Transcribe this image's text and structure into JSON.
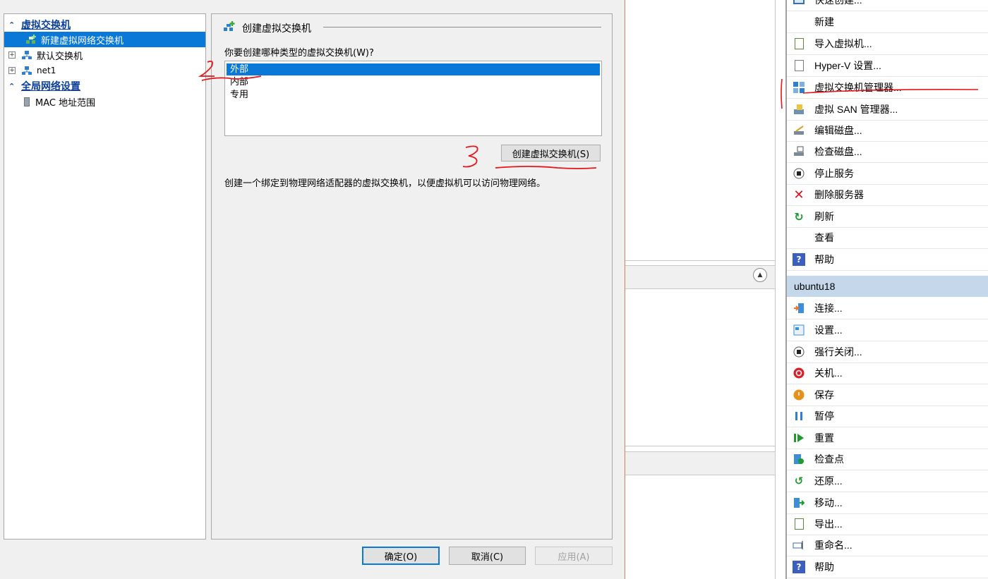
{
  "actions": {
    "top_items": [
      {
        "label": "快速创建...",
        "icon": "monitor-icon"
      },
      {
        "label": "新建",
        "icon": ""
      },
      {
        "label": "导入虚拟机...",
        "icon": "import-icon"
      },
      {
        "label": "Hyper-V 设置...",
        "icon": "settings-doc-icon"
      },
      {
        "label": "虚拟交换机管理器...",
        "icon": "switch-manager-icon"
      },
      {
        "label": "虚拟 SAN 管理器...",
        "icon": "san-manager-icon"
      },
      {
        "label": "编辑磁盘...",
        "icon": "edit-disk-icon"
      },
      {
        "label": "检查磁盘...",
        "icon": "inspect-disk-icon"
      },
      {
        "label": "停止服务",
        "icon": "stop-icon"
      },
      {
        "label": "删除服务器",
        "icon": "delete-icon"
      },
      {
        "label": "刷新",
        "icon": "refresh-icon"
      },
      {
        "label": "查看",
        "icon": ""
      },
      {
        "label": "帮助",
        "icon": "help-icon"
      }
    ],
    "vm_name": "ubuntu18",
    "vm_items": [
      {
        "label": "连接...",
        "icon": "connect-icon"
      },
      {
        "label": "设置...",
        "icon": "settings-icon"
      },
      {
        "label": "强行关闭...",
        "icon": "turn-off-icon"
      },
      {
        "label": "关机...",
        "icon": "shutdown-icon"
      },
      {
        "label": "保存",
        "icon": "save-icon"
      },
      {
        "label": "暂停",
        "icon": "pause-icon"
      },
      {
        "label": "重置",
        "icon": "reset-icon"
      },
      {
        "label": "检查点",
        "icon": "checkpoint-icon"
      },
      {
        "label": "还原...",
        "icon": "revert-icon"
      },
      {
        "label": "移动...",
        "icon": "move-icon"
      },
      {
        "label": "导出...",
        "icon": "export-icon"
      },
      {
        "label": "重命名...",
        "icon": "rename-icon"
      },
      {
        "label": "帮助",
        "icon": "help-icon"
      }
    ]
  },
  "dialog": {
    "tree": {
      "section1": "虚拟交换机",
      "new_switch": "新建虚拟网络交换机",
      "default_switch": "默认交换机",
      "net1": "net1",
      "section2": "全局网络设置",
      "mac_range": "MAC 地址范围"
    },
    "group_title": "创建虚拟交换机",
    "question": "你要创建哪种类型的虚拟交换机(W)?",
    "types": [
      "外部",
      "内部",
      "专用"
    ],
    "selected_type": "外部",
    "create_button": "创建虚拟交换机(S)",
    "description": "创建一个绑定到物理网络适配器的虚拟交换机，以便虚拟机可以访问物理网络。",
    "ok": "确定(O)",
    "cancel": "取消(C)",
    "apply": "应用(A)"
  },
  "annotations": {
    "step2": "2",
    "step3": "3"
  },
  "colors": {
    "selection": "#0a78d7",
    "section_link": "#0b3f9a",
    "annotation_red": "#e8141c",
    "vm_header": "#c5d7ea"
  }
}
